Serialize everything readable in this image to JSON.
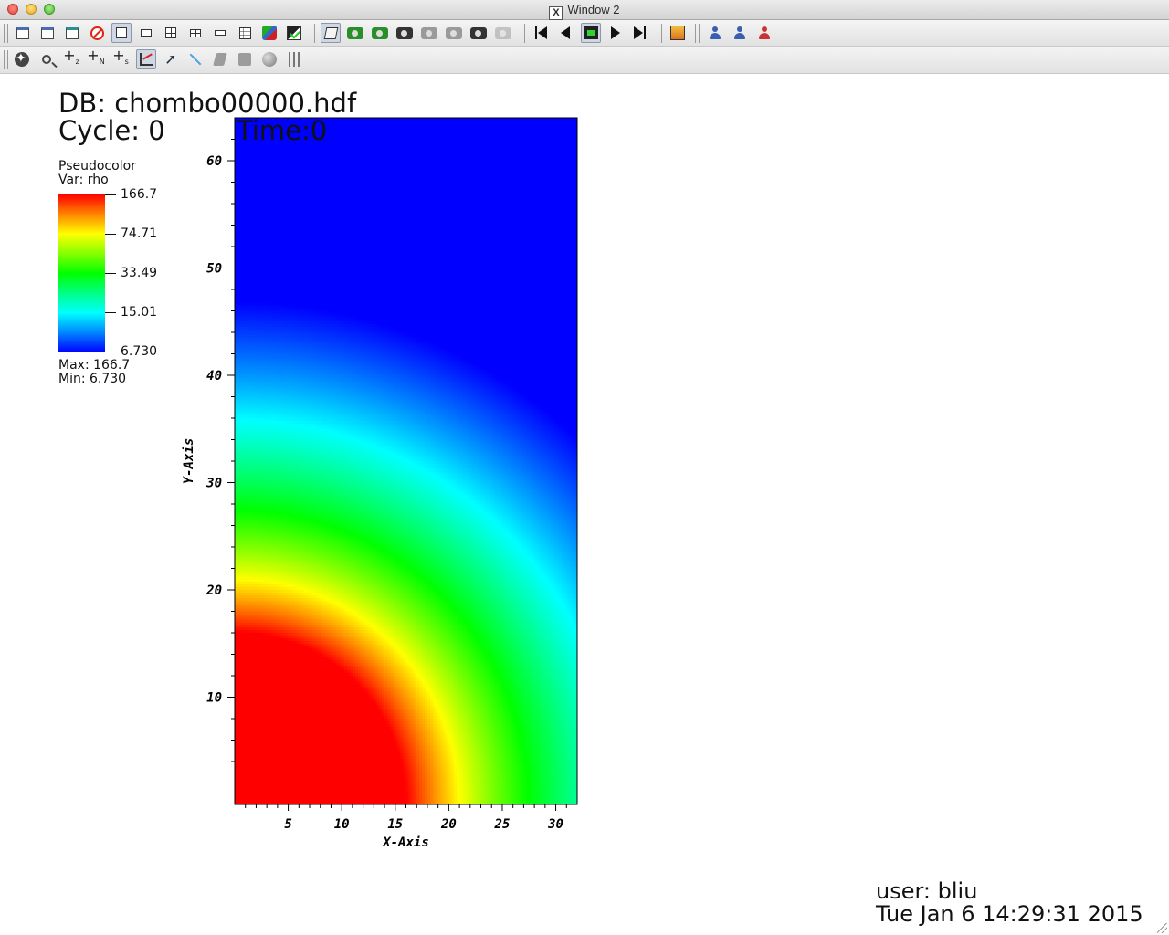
{
  "window": {
    "title": "Window 2",
    "x_badge": "X"
  },
  "toolbar1": {
    "items": [
      "new-window",
      "clone-window",
      "copy-window",
      "delete-window",
      "layout-1x1",
      "layout-1x2",
      "layout-2x2",
      "layout-2x4",
      "layout-4x4",
      "layout-3x3",
      "toggle-lock",
      "toggle-spin",
      "view-3d",
      "save-view",
      "save-movie",
      "snapshot",
      "snapshot-2",
      "snapshot-3",
      "snapshot-4",
      "snapshot-5",
      "rewind",
      "reverse",
      "stop",
      "play",
      "step-forward",
      "engine",
      "user-1",
      "user-2",
      "user-3"
    ]
  },
  "toolbar2": {
    "items": [
      "navigate",
      "zoom",
      "zone-pick",
      "node-pick",
      "spreadsheet-pick",
      "lineout",
      "pick",
      "line",
      "plane",
      "box",
      "sphere",
      "sliders"
    ],
    "plus_z": "+",
    "plus_z_sub": "z",
    "plus_n": "+",
    "plus_n_sub": "N",
    "plus_s": "+",
    "plus_s_sub": "s"
  },
  "vis": {
    "db_line": "DB: chombo00000.hdf",
    "cycle_line": "Cycle: 0",
    "time_line": "Time:0",
    "legend": {
      "title": "Pseudocolor",
      "var": "Var: rho",
      "labels": [
        "166.7",
        "74.71",
        "33.49",
        "15.01",
        "6.730"
      ],
      "max": "Max:  166.7",
      "min": "Min:  6.730"
    },
    "user": "user: bliu",
    "date": "Tue Jan  6 14:29:31 2015"
  },
  "chart_data": {
    "type": "heatmap",
    "xlabel": "X-Axis",
    "ylabel": "Y-Axis",
    "xlim": [
      0,
      32
    ],
    "ylim": [
      0,
      64
    ],
    "xticks": [
      5,
      10,
      15,
      20,
      25,
      30
    ],
    "yticks": [
      10,
      20,
      30,
      40,
      50,
      60
    ],
    "variable": "rho",
    "colormap": "hot-to-cold",
    "color_range": [
      6.73,
      166.7
    ],
    "core_radius": 16,
    "field": "radial decay from origin"
  }
}
